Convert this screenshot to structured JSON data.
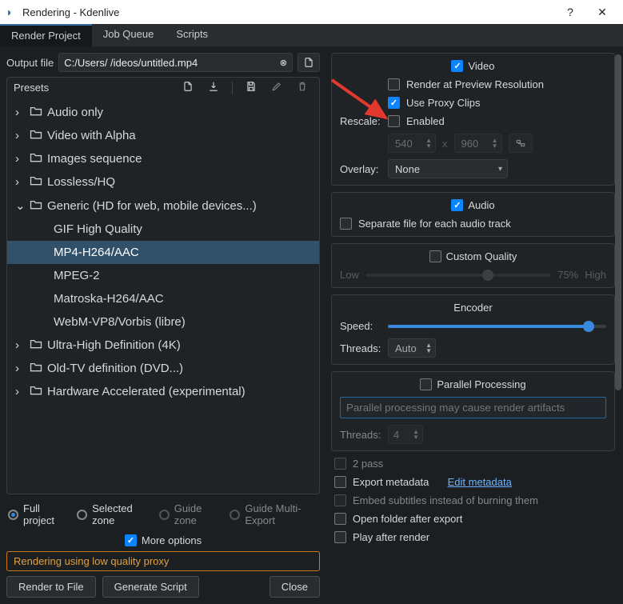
{
  "window": {
    "title": "Rendering - Kdenlive"
  },
  "tabs": {
    "render_project": "Render Project",
    "job_queue": "Job Queue",
    "scripts": "Scripts",
    "active": 0
  },
  "output": {
    "label": "Output file",
    "path": "C:/Users/        /ideos/untitled.mp4"
  },
  "presets": {
    "header": "Presets",
    "groups": [
      {
        "label": "Audio only",
        "expanded": false
      },
      {
        "label": "Video with Alpha",
        "expanded": false
      },
      {
        "label": "Images sequence",
        "expanded": false
      },
      {
        "label": "Lossless/HQ",
        "expanded": false
      },
      {
        "label": "Generic (HD for web, mobile devices...)",
        "expanded": true,
        "children": [
          "GIF High Quality",
          "MP4-H264/AAC",
          "MPEG-2",
          "Matroska-H264/AAC",
          "WebM-VP8/Vorbis (libre)"
        ],
        "selected": 1
      },
      {
        "label": "Ultra-High Definition (4K)",
        "expanded": false
      },
      {
        "label": "Old-TV definition (DVD...)",
        "expanded": false
      },
      {
        "label": "Hardware Accelerated (experimental)",
        "expanded": false
      }
    ]
  },
  "video": {
    "heading": "Video",
    "checked": true,
    "render_preview": "Render at Preview Resolution",
    "render_preview_checked": false,
    "use_proxy": "Use Proxy Clips",
    "use_proxy_checked": true,
    "rescale_label": "Rescale:",
    "rescale_enabled_label": "Enabled",
    "rescale_enabled_checked": false,
    "rescale_w": "540",
    "rescale_h": "960",
    "overlay_label": "Overlay:",
    "overlay_value": "None"
  },
  "audio": {
    "heading": "Audio",
    "checked": true,
    "separate_file": "Separate file for each audio track",
    "separate_file_checked": false
  },
  "quality": {
    "heading": "Custom Quality",
    "checked": false,
    "low": "Low",
    "high": "High",
    "percent": "75%",
    "slider_percent": 75
  },
  "encoder": {
    "heading": "Encoder",
    "speed_label": "Speed:",
    "speed_percent": 95,
    "threads_label": "Threads:",
    "threads_value": "Auto"
  },
  "parallel": {
    "heading": "Parallel Processing",
    "checked": false,
    "warning_placeholder": "Parallel processing may cause render artifacts",
    "threads_label": "Threads:",
    "threads_value": "4"
  },
  "extras": {
    "two_pass": "2 pass",
    "two_pass_checked": false,
    "export_metadata": "Export metadata",
    "export_metadata_checked": false,
    "edit_metadata": "Edit metadata",
    "embed_subtitles": "Embed subtitles instead of burning them",
    "embed_subtitles_checked": false,
    "open_folder": "Open folder after export",
    "open_folder_checked": false,
    "play_after": "Play after render",
    "play_after_checked": false
  },
  "range": {
    "full": "Full project",
    "selected_zone": "Selected zone",
    "guide_zone": "Guide zone",
    "guide_multi": "Guide Multi-Export",
    "active": 0
  },
  "more_options": {
    "label": "More options",
    "checked": true
  },
  "warning": "Rendering using low quality proxy",
  "buttons": {
    "render": "Render to File",
    "generate": "Generate Script",
    "close": "Close"
  }
}
